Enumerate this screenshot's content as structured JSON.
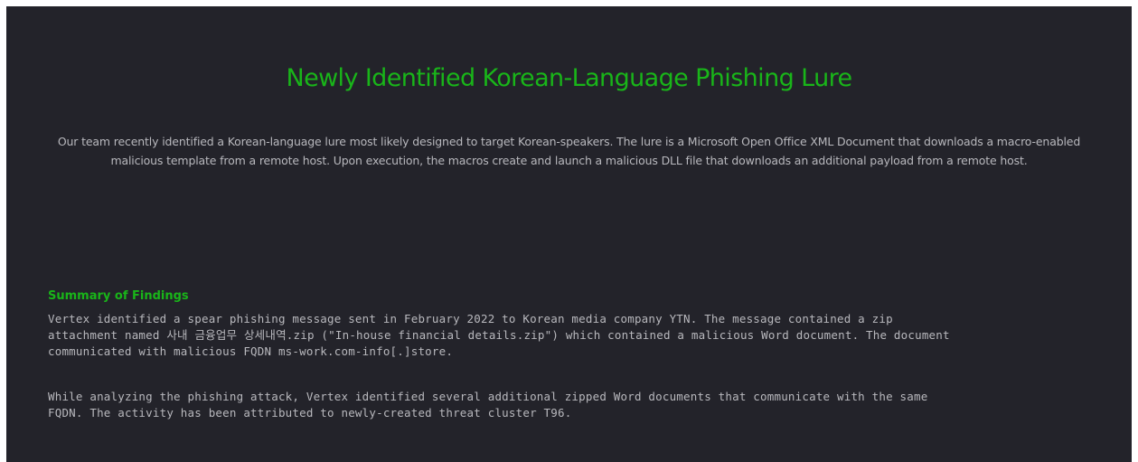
{
  "article": {
    "title": "Newly Identified Korean-Language Phishing Lure",
    "intro": "Our team recently identified a Korean-language lure most likely designed to target Korean-speakers. The lure is a Microsoft Open Office XML Document that downloads a macro-enabled malicious template from a remote host. Upon execution, the macros create and launch a malicious DLL file that downloads an additional payload from a remote host.",
    "summary_heading": "Summary of Findings",
    "paragraph1": [
      "Vertex identified a spear phishing message sent in February 2022 to Korean media company YTN. The message contained a zip",
      "attachment named 사내 금융업무 상세내역.zip (\"In-house financial details.zip\") which contained a malicious Word document. The document",
      "communicated with malicious FQDN ms-work.com-info[.]store."
    ],
    "paragraph2": [
      "While analyzing the phishing attack, Vertex identified several additional zipped Word documents that communicate with the same",
      "FQDN. The activity has been attributed to newly-created threat cluster T96."
    ]
  },
  "colors": {
    "background": "#23232a",
    "accent": "#19b519",
    "text": "#b8b8bd"
  }
}
